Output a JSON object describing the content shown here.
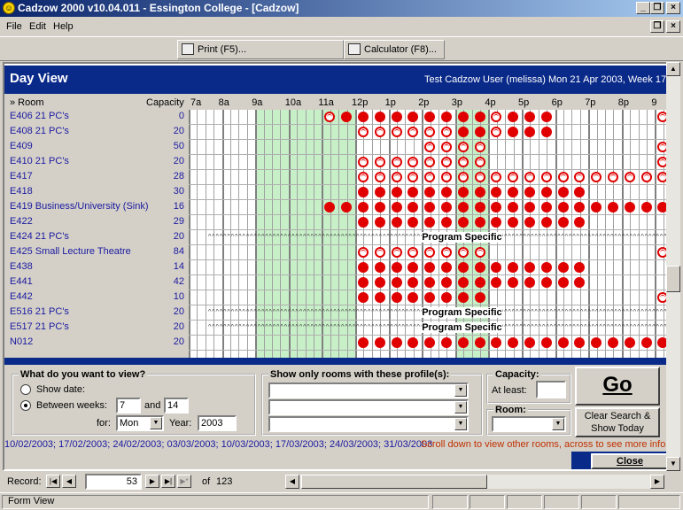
{
  "window": {
    "title": "Cadzow 2000 v10.04.011 - Essington College - [Cadzow]"
  },
  "menu": [
    "File",
    "Edit",
    "Help"
  ],
  "toolbar": {
    "print": "Print (F5)...",
    "calculator": "Calculator (F8)..."
  },
  "dayview": {
    "title": "Day View",
    "user": "Test Cadzow User (melissa) Mon 21 Apr 2003, Week 17"
  },
  "grid_header": {
    "room": "» Room",
    "capacity": "Capacity",
    "hours": [
      "7a",
      "8a",
      "9a",
      "10a",
      "11a",
      "12p",
      "1p",
      "2p",
      "3p",
      "4p",
      "5p",
      "6p",
      "7p",
      "8p",
      "9"
    ]
  },
  "rooms": [
    {
      "name": "E406 21 PC's",
      "capacity": "0",
      "slots": "........rdddddddddrddd......rrrdddrrrr.."
    },
    {
      "name": "E408 21 PC's",
      "capacity": "20",
      "slots": "..........rrrrrrddrddd..........rrrrrr.."
    },
    {
      "name": "E409",
      "capacity": "50",
      "slots": "..............rrrr..........rrrrdddddr.."
    },
    {
      "name": "E410 21 PC's",
      "capacity": "20",
      "slots": "..........rrrrrrrr..........rrrrrrdddddd"
    },
    {
      "name": "E417",
      "capacity": "28",
      "slots": "..........rrrrrrrrrrrrrrrrrrrrrrrrrrrrrr"
    },
    {
      "name": "E418",
      "capacity": "30",
      "slots": "..........dddddddddddddd..........rrrrrr"
    },
    {
      "name": "E419 Business/University (Sink)",
      "capacity": "16",
      "slots": "........dddddddddddddddddddddddddddddddd"
    },
    {
      "name": "E422",
      "capacity": "29",
      "slots": "..........dddddddddddddd..........rrrrrr"
    },
    {
      "name": "E424 21 PC's",
      "capacity": "20",
      "slots": "PROG"
    },
    {
      "name": "E425 Small Lecture Theatre",
      "capacity": "84",
      "slots": "..........rrrrrrrr..........rrrrdddddd.."
    },
    {
      "name": "E438",
      "capacity": "14",
      "slots": "..........dddddddddddddd..........rrrrrr"
    },
    {
      "name": "E441",
      "capacity": "42",
      "slots": "..........dddddddddddddd..........dddddd"
    },
    {
      "name": "E442",
      "capacity": "10",
      "slots": "..........dddddddd..........rrrrrrrrrr.."
    },
    {
      "name": "E516 21 PC's",
      "capacity": "20",
      "slots": "PROG"
    },
    {
      "name": "E517 21 PC's",
      "capacity": "20",
      "slots": "PROG"
    },
    {
      "name": "N012",
      "capacity": "20",
      "slots": "..........dddddddddddddddddddddddddddddd"
    }
  ],
  "program_specific": "Program Specific",
  "view_panel": {
    "title": "What do you want to view?",
    "show_date": "Show date:",
    "between_weeks": "Between weeks:",
    "week_from": "7",
    "and": "and",
    "week_to": "14",
    "for": "for:",
    "day": "Mon",
    "year_label": "Year:",
    "year": "2003"
  },
  "profile_panel": {
    "title": "Show only rooms with these profile(s):"
  },
  "capacity_panel": {
    "title": "Capacity:",
    "at_least": "At least:"
  },
  "room_panel": {
    "title": "Room:"
  },
  "buttons": {
    "go": "Go",
    "clear_search": "Clear Search & Show Today",
    "close": "Close"
  },
  "dates_line": "10/02/2003; 17/02/2003; 24/02/2003; 03/03/2003; 10/03/2003; 17/03/2003; 24/03/2003; 31/03/2003",
  "scroll_msg": "Scroll down to view other rooms, across to see more info",
  "record": {
    "label": "Record:",
    "value": "53",
    "of": "of",
    "total": "123"
  },
  "status": {
    "text": "Form View"
  }
}
